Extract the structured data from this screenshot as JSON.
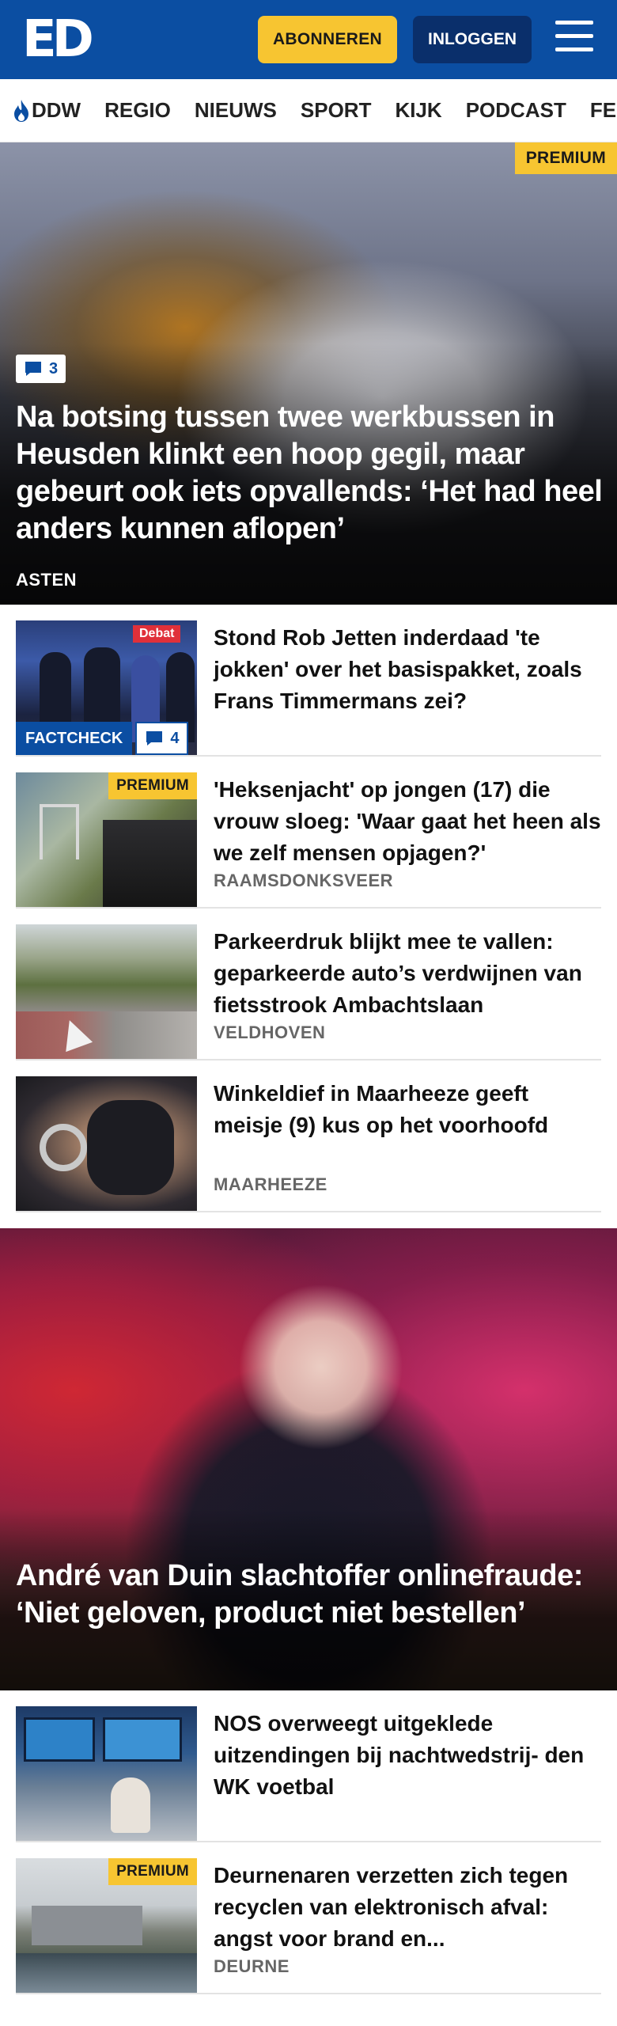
{
  "header": {
    "logo": "ED",
    "subscribe_label": "ABONNEREN",
    "login_label": "INLOGGEN"
  },
  "nav": {
    "items": [
      "DDW",
      "REGIO",
      "NIEUWS",
      "SPORT",
      "KIJK",
      "PODCAST",
      "FEE"
    ]
  },
  "hero": {
    "badge": "PREMIUM",
    "comments": "3",
    "title": "Na botsing tussen twee werkbussen in Heusden klinkt een hoop gegil, maar gebeurt ook iets opvallends: ‘Het had heel anders kunnen aflopen’",
    "location": "ASTEN"
  },
  "articles": [
    {
      "title": "Stond Rob Jetten inderdaad 'te jokken' over het basispakket, zoals Frans Timmermans zei?",
      "label": "FACTCHECK",
      "comments": "4",
      "thumb_text": "Debat"
    },
    {
      "badge": "PREMIUM",
      "title": "'Heksenjacht' op jongen (17) die vrouw sloeg: 'Waar gaat het heen als we zelf mensen opjagen?'",
      "location": "RAAMSDONKSVEER"
    },
    {
      "title": "Parkeerdruk blijkt mee te vallen: geparkeerde auto’s verdwijnen van fietsstrook Ambachtslaan",
      "location": "VELDHOVEN"
    },
    {
      "title": "Winkeldief in Maarheeze geeft meisje (9) kus op het voorhoofd",
      "location": "MAARHEEZE"
    }
  ],
  "hero2": {
    "title": "André van Duin slachtoffer onlinefraude: ‘Niet geloven, product niet bestellen’"
  },
  "articles2": [
    {
      "title": "NOS overweegt uitgeklede uitzendingen bij nachtwedstrij- den WK voetbal"
    },
    {
      "badge": "PREMIUM",
      "title": "Deurnenaren verzetten zich tegen recyclen van elektronisch afval: angst voor brand en...",
      "location": "DEURNE"
    }
  ],
  "colors": {
    "brand_blue": "#0b4ea2",
    "premium_yellow": "#f7c531",
    "dark_blue": "#0a2f6b"
  }
}
